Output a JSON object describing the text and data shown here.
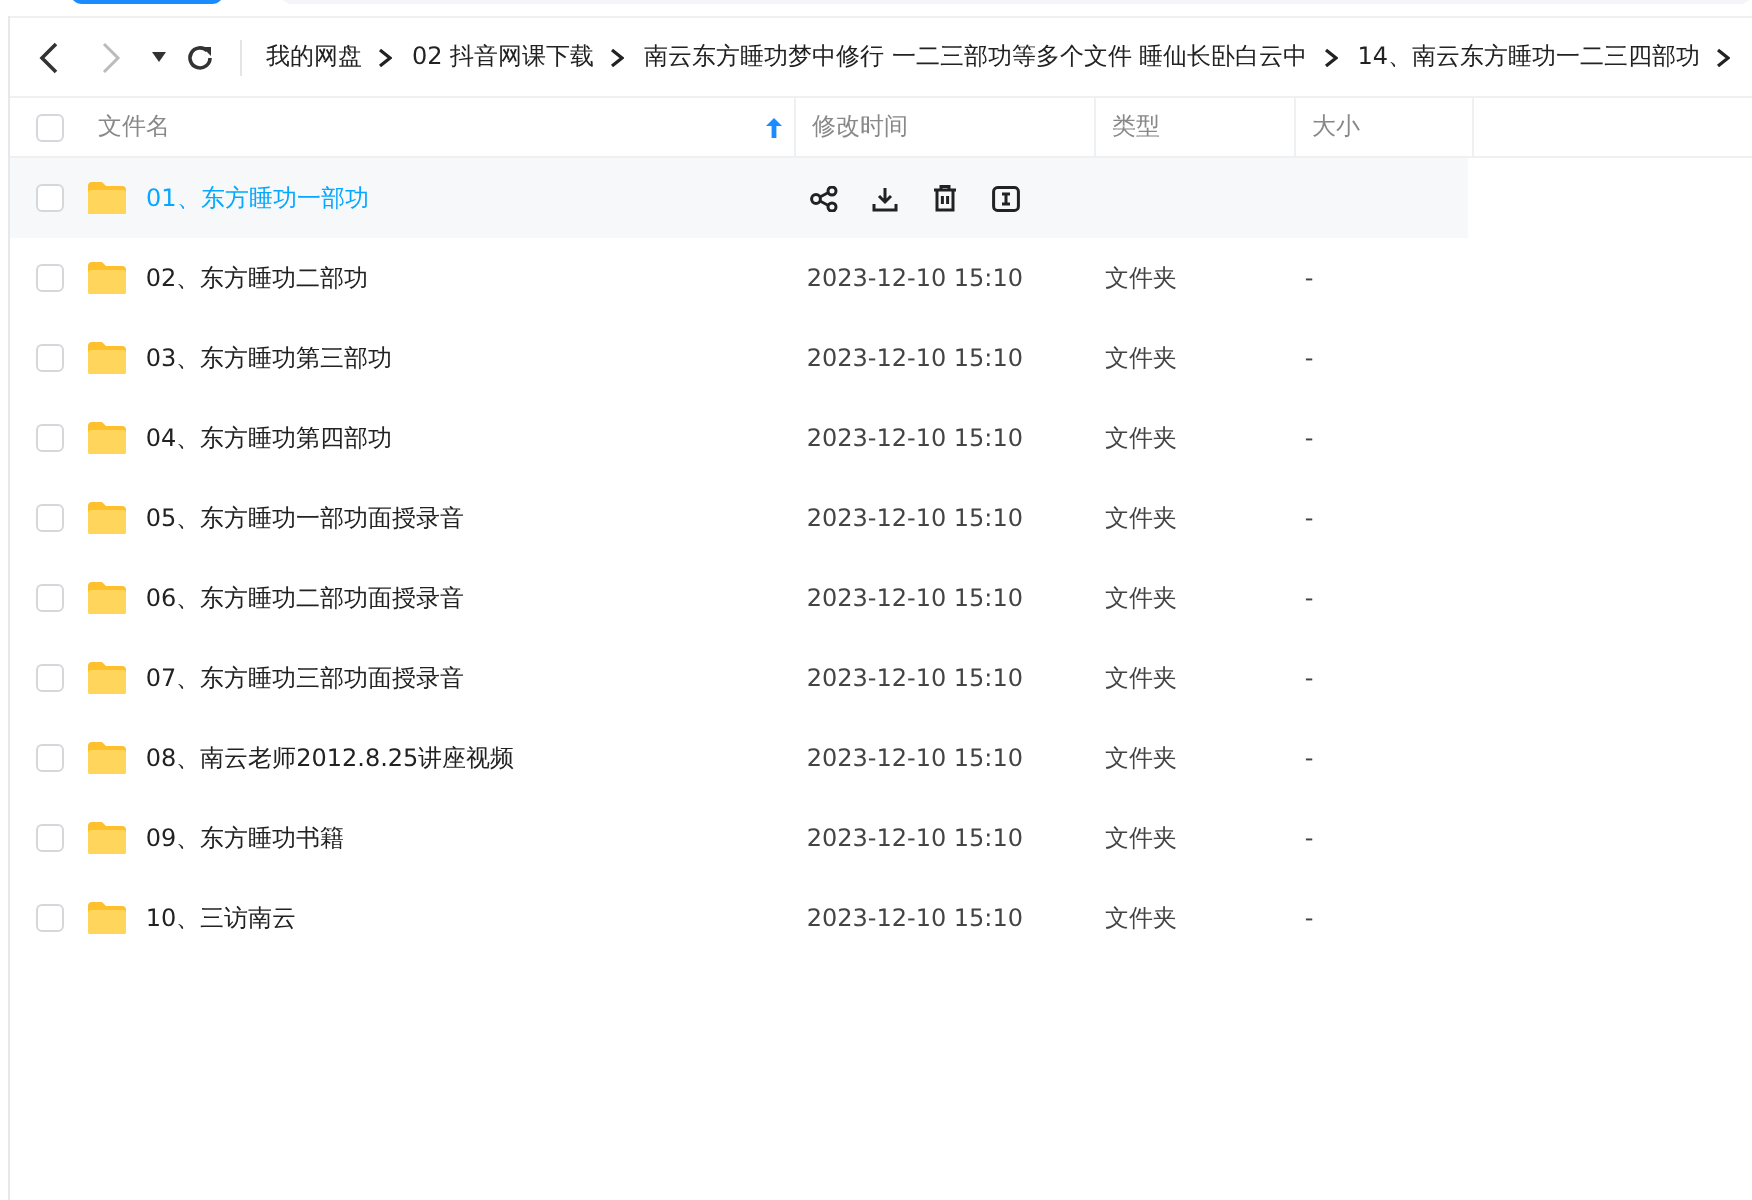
{
  "breadcrumbs": [
    "我的网盘",
    "02 抖音网课下载",
    "南云东方睡功梦中修行  一二三部功等多个文件 睡仙长卧白云中",
    "14、南云东方睡功一二三四部功"
  ],
  "columns": {
    "name": "文件名",
    "modified": "修改时间",
    "type": "类型",
    "size": "大小"
  },
  "sort_ascending": true,
  "select_all_checked": false,
  "rows": [
    {
      "name": "01、东方睡功一部功",
      "hovered": true,
      "checked": false
    },
    {
      "name": "02、东方睡功二部功",
      "hovered": false,
      "checked": false,
      "modified": "2023-12-10 15:10",
      "type": "文件夹",
      "size": "-"
    },
    {
      "name": "03、东方睡功第三部功",
      "hovered": false,
      "checked": false,
      "modified": "2023-12-10 15:10",
      "type": "文件夹",
      "size": "-"
    },
    {
      "name": "04、东方睡功第四部功",
      "hovered": false,
      "checked": false,
      "modified": "2023-12-10 15:10",
      "type": "文件夹",
      "size": "-"
    },
    {
      "name": "05、东方睡功一部功面授录音",
      "hovered": false,
      "checked": false,
      "modified": "2023-12-10 15:10",
      "type": "文件夹",
      "size": "-"
    },
    {
      "name": "06、东方睡功二部功面授录音",
      "hovered": false,
      "checked": false,
      "modified": "2023-12-10 15:10",
      "type": "文件夹",
      "size": "-"
    },
    {
      "name": "07、东方睡功三部功面授录音",
      "hovered": false,
      "checked": false,
      "modified": "2023-12-10 15:10",
      "type": "文件夹",
      "size": "-"
    },
    {
      "name": "08、南云老师2012.8.25讲座视频",
      "hovered": false,
      "checked": false,
      "modified": "2023-12-10 15:10",
      "type": "文件夹",
      "size": "-"
    },
    {
      "name": "09、东方睡功书籍",
      "hovered": false,
      "checked": false,
      "modified": "2023-12-10 15:10",
      "type": "文件夹",
      "size": "-"
    },
    {
      "name": "10、三访南云",
      "hovered": false,
      "checked": false,
      "modified": "2023-12-10 15:10",
      "type": "文件夹",
      "size": "-"
    }
  ]
}
